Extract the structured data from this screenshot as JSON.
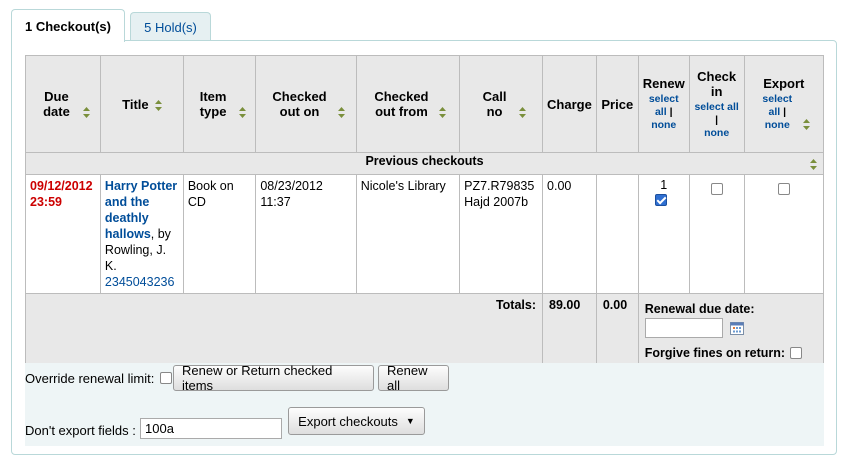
{
  "tabs": {
    "checkouts": "1 Checkout(s)",
    "holds": "5 Hold(s)"
  },
  "table": {
    "headers": {
      "due_date": "Due date",
      "title": "Title",
      "item_type": "Item type",
      "checked_out_on": "Checked out on",
      "checked_out_from": "Checked out from",
      "call_no": "Call no",
      "charge": "Charge",
      "price": "Price",
      "renew": "Renew",
      "check_in": "Check in",
      "export": "Export"
    },
    "select_all": "select all",
    "separator": "|",
    "none": "none",
    "group_label": "Previous checkouts",
    "row": {
      "due_date": "09/12/2012",
      "due_time": "23:59",
      "title": "Harry Potter and the deathly hallows",
      "by_text": ", by Rowling, J. K.",
      "barcode": "2345043236",
      "item_type": "Book on CD",
      "checked_out_date": "08/23/2012",
      "checked_out_time": "11:37",
      "checked_out_from": "Nicole's Library",
      "call_no_1": "PZ7.R79835",
      "call_no_2": "Hajd 2007b",
      "charge": "0.00",
      "price": "",
      "renew_count": "1",
      "renew_checked": true,
      "checkin_checked": false,
      "export_checked": false
    },
    "totals": {
      "label": "Totals:",
      "charge": "89.00",
      "price": "0.00",
      "renewal_due_label": "Renewal due date:",
      "renewal_due_value": "",
      "forgive_label": "Forgive fines on return:"
    }
  },
  "footer": {
    "override_label": "Override renewal limit:",
    "renew_return_button": "Renew or Return checked items",
    "renew_all_button": "Renew all",
    "dont_export_label": "Don't export fields :",
    "dont_export_value": "100a",
    "export_button": "Export checkouts"
  },
  "colors": {
    "link": "#004d99",
    "due": "#cc0000",
    "header_bg": "#e8e8e8",
    "tab_border": "#b9d8d9"
  }
}
